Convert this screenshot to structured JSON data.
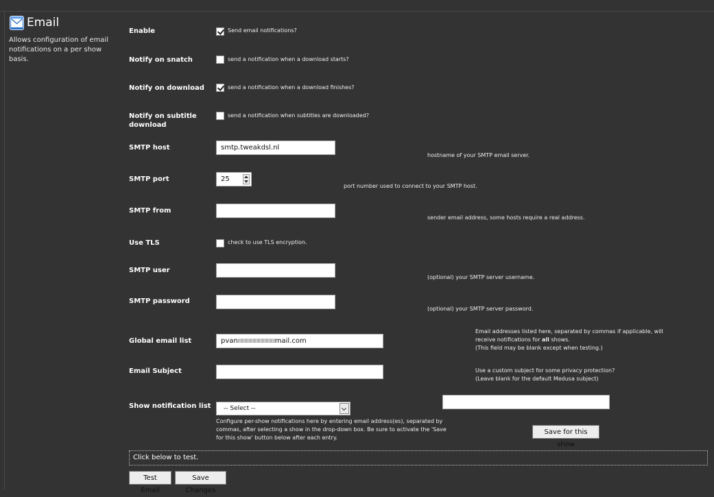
{
  "header": {
    "icon": "email-envelope-icon",
    "title": "Email",
    "description": "Allows configuration of email notifications on a per show basis."
  },
  "enable": {
    "label": "Enable",
    "checked": true,
    "text": "Send email notifications?"
  },
  "notify_snatch": {
    "label": "Notify on snatch",
    "checked": false,
    "text": "send a notification when a download starts?"
  },
  "notify_download": {
    "label": "Notify on download",
    "checked": true,
    "text": "send a notification when a download finishes?"
  },
  "notify_subtitle": {
    "label": "Notify on subtitle download",
    "checked": false,
    "text": "send a notification when subtitles are downloaded?"
  },
  "smtp_host": {
    "label": "SMTP host",
    "value": "smtp.tweakdsl.nl",
    "help": "hostname of your SMTP email server."
  },
  "smtp_port": {
    "label": "SMTP port",
    "value": "25",
    "help": "port number used to connect to your SMTP host."
  },
  "smtp_from": {
    "label": "SMTP from",
    "value": "",
    "help": "sender email address, some hosts require a real address."
  },
  "use_tls": {
    "label": "Use TLS",
    "checked": false,
    "text": "check to use TLS encryption."
  },
  "smtp_user": {
    "label": "SMTP user",
    "value": "",
    "help": "(optional) your SMTP server username."
  },
  "smtp_password": {
    "label": "SMTP password",
    "value": "",
    "help": "(optional) your SMTP server password."
  },
  "global_email": {
    "label": "Global email list",
    "value_start": "pvan",
    "value_end": "mail.com",
    "help_line1_pre": "Email addresses listed here, separated by commas if applicable, will",
    "help_line2_pre": "receive notifications for ",
    "help_line2_bold": "all",
    "help_line2_post": " shows.",
    "help_line3": "(This field may be blank except when testing.)"
  },
  "email_subject": {
    "label": "Email Subject",
    "value": "",
    "help_line1": "Use a custom subject for some privacy protection?",
    "help_line2": "(Leave blank for the default Medusa subject)"
  },
  "show_list": {
    "label": "Show notification list",
    "selected": "-- Select --",
    "help_line1": "Configure per-show notifications here by entering email address(es), separated by",
    "help_line2": "commas, after selecting a show in the drop-down box. Be sure to activate the 'Save",
    "help_line3": "for this show' button below after each entry.",
    "per_show_value": "",
    "save_show_button": "Save for this show"
  },
  "test": {
    "text": "Click below to test.",
    "test_button": "Test Email",
    "save_button": "Save Changes"
  }
}
